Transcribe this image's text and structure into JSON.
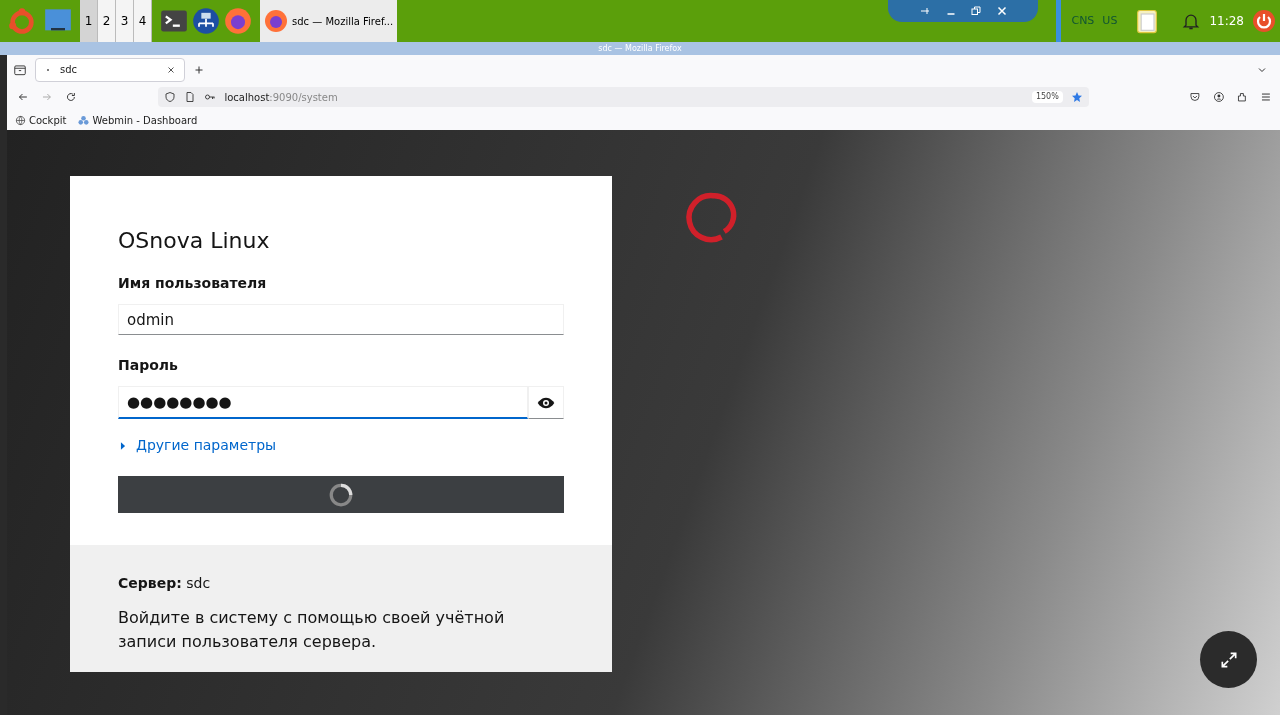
{
  "taskbar": {
    "workspaces": [
      {
        "label": "1",
        "selected": true
      },
      {
        "label": "2",
        "selected": false
      },
      {
        "label": "3",
        "selected": false
      },
      {
        "label": "4",
        "selected": false
      }
    ],
    "task": {
      "title": "sdc — Mozilla Firef..."
    },
    "keyboard_layouts": [
      "CNS",
      "US"
    ],
    "clock": "11:28"
  },
  "window": {
    "title": "sdc — Mozilla Firefox"
  },
  "tabs": [
    {
      "label": "sdc",
      "selected": true
    }
  ],
  "address_bar": {
    "host": "localhost",
    "path": ":9090/system",
    "zoom": "150%"
  },
  "bookmarks": [
    "Cockpit",
    "Webmin - Dashboard"
  ],
  "login": {
    "title": "OSnova Linux",
    "username_label": "Имя пользователя",
    "username": "odmin",
    "password_label": "Пароль",
    "password": "●●●●●●●●",
    "more_options": "Другие параметры",
    "server_label": "Сервер:",
    "server": "sdc",
    "hint": "Войдите в систему с помощью своей учётной записи пользователя сервера."
  }
}
